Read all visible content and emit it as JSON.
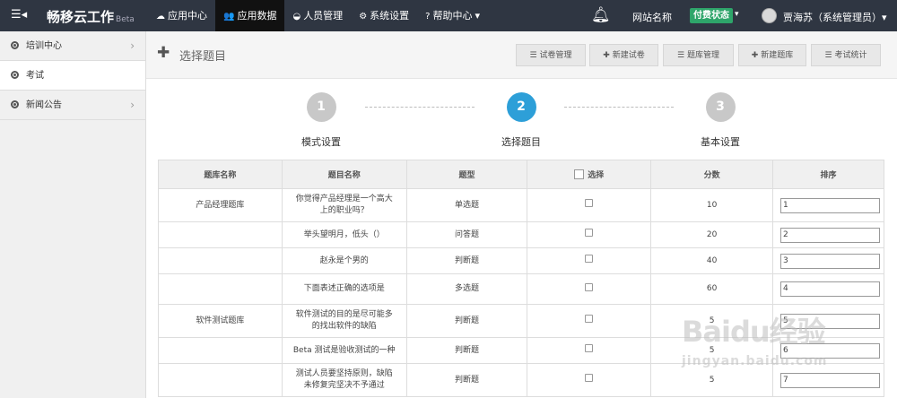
{
  "topbar": {
    "toggle_icon": "menu-collapse-icon",
    "brand": "畅移云工作",
    "brand_suffix": "Beta",
    "nav": [
      {
        "label": "应用中心",
        "icon": "cloud-icon",
        "glyph": "☁",
        "active": false
      },
      {
        "label": "应用数据",
        "icon": "users-icon",
        "glyph": "👥",
        "active": true
      },
      {
        "label": "人员管理",
        "icon": "dashboard-icon",
        "glyph": "◒",
        "active": false
      },
      {
        "label": "系统设置",
        "icon": "gears-icon",
        "glyph": "⚙",
        "active": false
      },
      {
        "label": "帮助中心",
        "icon": "question-icon",
        "glyph": "?",
        "active": false,
        "dropdown": "▾"
      }
    ],
    "site_name": "网站名称",
    "status_badge": "付费状态",
    "status_color": "#2ea56a",
    "user": "贾海苏（系统管理员）▾"
  },
  "sidebar": {
    "items": [
      {
        "label": "培训中心",
        "has_arrow": true
      },
      {
        "label": "考试",
        "has_arrow": false,
        "active": true
      },
      {
        "label": "新闻公告",
        "has_arrow": true
      }
    ]
  },
  "header": {
    "title": "选择题目",
    "buttons": [
      {
        "label": "试卷管理",
        "icon": "list-icon",
        "glyph": "☰"
      },
      {
        "label": "新建试卷",
        "icon": "plus-icon",
        "glyph": "✚"
      },
      {
        "label": "题库管理",
        "icon": "list-icon",
        "glyph": "☰"
      },
      {
        "label": "新建题库",
        "icon": "plus-icon",
        "glyph": "✚"
      },
      {
        "label": "考试统计",
        "icon": "list-icon",
        "glyph": "☰"
      }
    ]
  },
  "steps": [
    {
      "number": "1",
      "label": "模式设置",
      "current": false
    },
    {
      "number": "2",
      "label": "选择题目",
      "current": true
    },
    {
      "number": "3",
      "label": "基本设置",
      "current": false
    }
  ],
  "table": {
    "headers": {
      "bank": "题库名称",
      "question": "题目名称",
      "type": "题型",
      "select": "选择",
      "score": "分数",
      "order": "排序"
    },
    "rows": [
      {
        "bank": "产品经理题库",
        "question": "你觉得产品经理是一个高大上的职业吗？",
        "type": "单选题",
        "score": "10",
        "order": "1"
      },
      {
        "bank": "",
        "question": "举头望明月，低头（）",
        "type": "问答题",
        "score": "20",
        "order": "2"
      },
      {
        "bank": "",
        "question": "赵永是个男的",
        "type": "判断题",
        "score": "40",
        "order": "3"
      },
      {
        "bank": "",
        "question": "下面表述正确的选项是",
        "type": "多选题",
        "score": "60",
        "order": "4"
      },
      {
        "bank": "软件测试题库",
        "question": "软件测试的目的是尽可能多的找出软件的缺陷",
        "type": "判断题",
        "score": "5",
        "order": "5"
      },
      {
        "bank": "",
        "question": "Beta 测试是验收测试的一种",
        "type": "判断题",
        "score": "5",
        "order": "6"
      },
      {
        "bank": "",
        "question": "测试人员要坚持原则，缺陷未修复完坚决不予通过",
        "type": "判断题",
        "score": "5",
        "order": "7"
      }
    ]
  },
  "watermark": {
    "line1": "Baidu经验",
    "line2": "jingyan.baidu.com"
  }
}
